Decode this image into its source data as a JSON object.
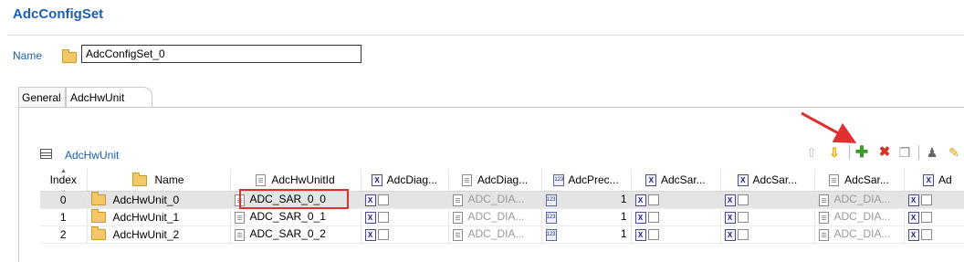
{
  "page": {
    "title": "AdcConfigSet"
  },
  "name_field": {
    "label": "Name",
    "value": "AdcConfigSet_0"
  },
  "tabs": [
    {
      "label": "General"
    },
    {
      "label": "AdcHwUnit"
    }
  ],
  "section": {
    "title": "AdcHwUnit"
  },
  "toolbar": {
    "up_icon": "arrow-up-icon",
    "down_icon": "arrow-down-icon",
    "add_icon": "plus-icon",
    "delete_icon": "x-icon",
    "copy_icon": "copy-icon",
    "user_icon": "user-icon",
    "edit_icon": "pencil-icon",
    "accent_add": "#3c9a2a",
    "accent_delete": "#d6312a"
  },
  "table": {
    "columns": [
      "Index",
      "Name",
      "AdcHwUnitId",
      "AdcDiag...",
      "AdcDiag...",
      "AdcPrec...",
      "AdcSar...",
      "AdcSar...",
      "AdcSar...",
      "Ad"
    ],
    "rows": [
      {
        "index": "0",
        "name": "AdcHwUnit_0",
        "hw_id": "ADC_SAR_0_0",
        "diag2": "ADC_DIA...",
        "prec": "1",
        "sar3": "ADC_DIA..."
      },
      {
        "index": "1",
        "name": "AdcHwUnit_1",
        "hw_id": "ADC_SAR_0_1",
        "diag2": "ADC_DIA...",
        "prec": "1",
        "sar3": "ADC_DIA..."
      },
      {
        "index": "2",
        "name": "AdcHwUnit_2",
        "hw_id": "ADC_SAR_0_2",
        "diag2": "ADC_DIA...",
        "prec": "1",
        "sar3": "ADC_DIA..."
      }
    ],
    "selected_row": 0,
    "highlight_color": "#e03030"
  }
}
